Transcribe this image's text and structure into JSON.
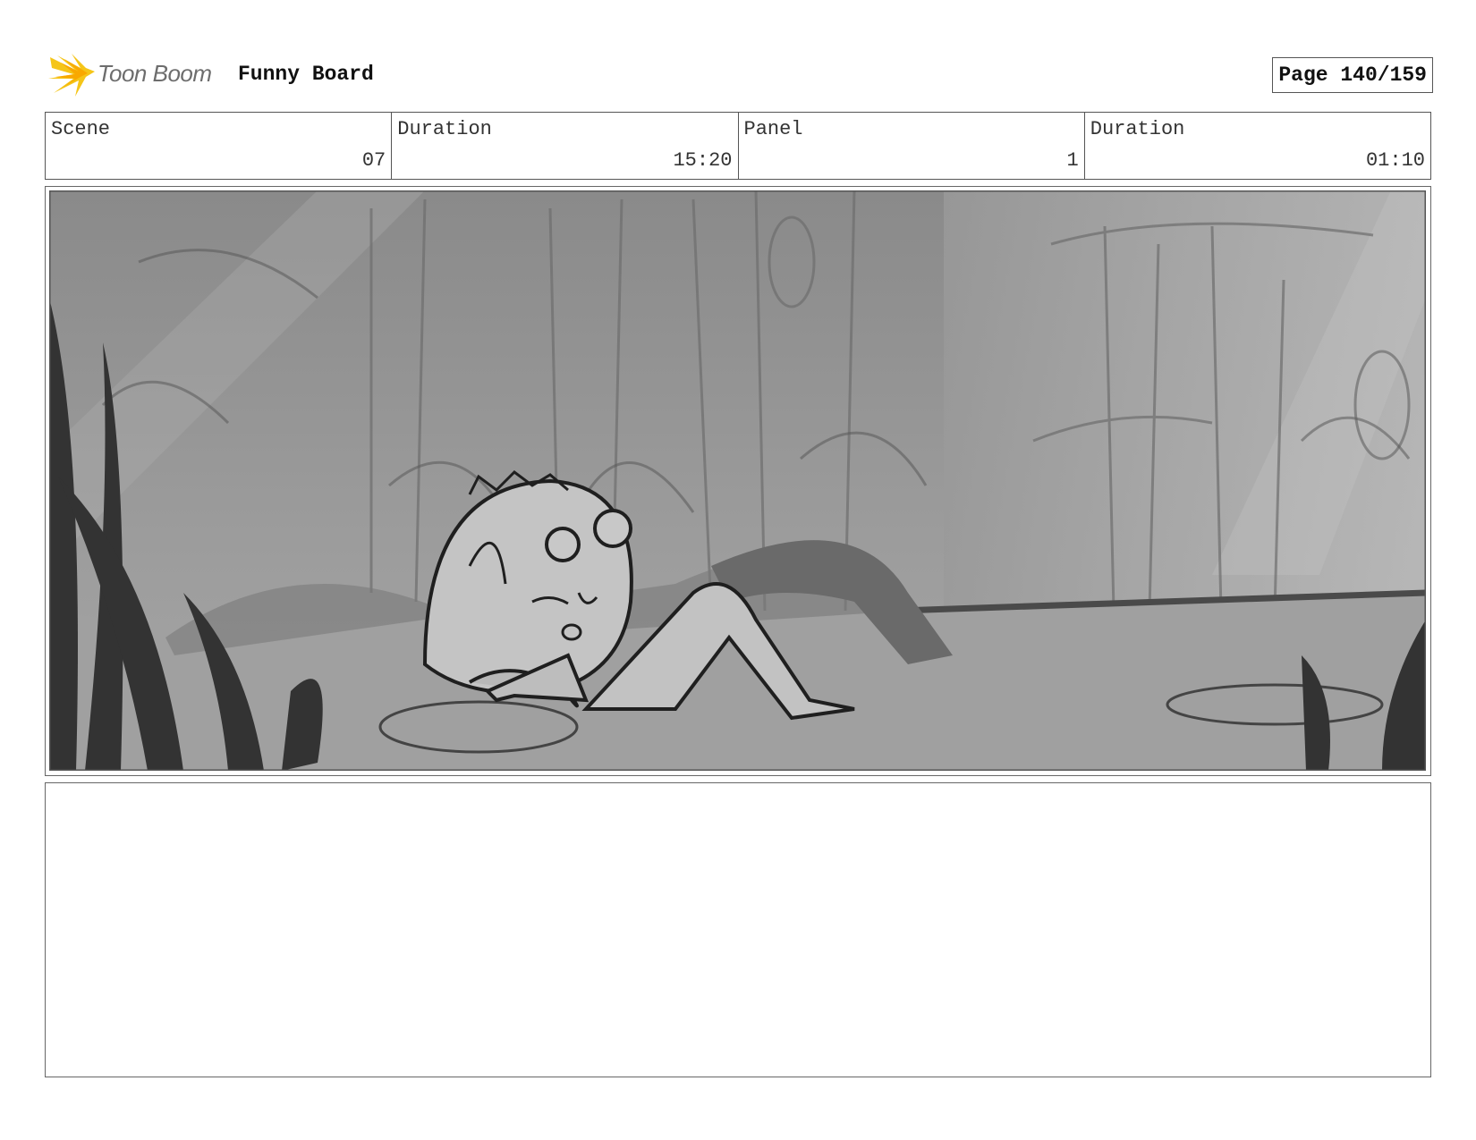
{
  "header": {
    "logo_text": "Toon Boom",
    "board_title": "Funny Board",
    "page_label": "Page 140/159"
  },
  "info": {
    "scene_label": "Scene",
    "scene_value": "07",
    "scene_duration_label": "Duration",
    "scene_duration_value": "15:20",
    "panel_label": "Panel",
    "panel_value": "1",
    "panel_duration_label": "Duration",
    "panel_duration_value": "01:10"
  },
  "colors": {
    "logo_yellow": "#f5c518",
    "logo_gray": "#6d6d6d",
    "border": "#555555"
  },
  "panel": {
    "description": ""
  },
  "notes": {
    "text": ""
  }
}
